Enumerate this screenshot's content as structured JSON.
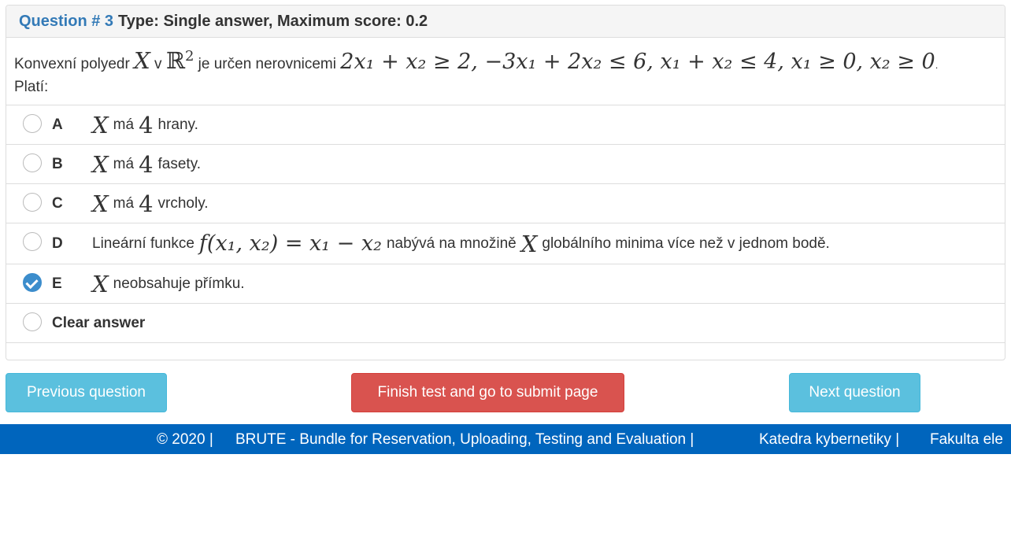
{
  "question": {
    "number_label": "Question # 3",
    "meta": "Type: Single answer, Maximum score: 0.2",
    "stem": {
      "part1": "Konvexní polyedr",
      "var_X": "X",
      "v": "v",
      "R": "ℝ",
      "sup2": "2",
      "part2": "je určen nerovnicemi",
      "formula": "2x₁ + x₂ ≥ 2, −3x₁ + 2x₂ ≤ 6, x₁ + x₂ ≤ 4, x₁ ≥ 0, x₂ ≥ 0",
      "dot": ".",
      "line2": "Platí:"
    }
  },
  "options": [
    {
      "letter": "A",
      "var": "X",
      "text1": "má",
      "num": "4",
      "text2": "hrany.",
      "checked": false
    },
    {
      "letter": "B",
      "var": "X",
      "text1": "má",
      "num": "4",
      "text2": "fasety.",
      "checked": false
    },
    {
      "letter": "C",
      "var": "X",
      "text1": "má",
      "num": "4",
      "text2": "vrcholy.",
      "checked": false
    },
    {
      "letter": "D",
      "text1": "Lineární funkce",
      "formula": "f(x₁, x₂) = x₁ − x₂",
      "text2": "nabývá na množině",
      "var": "X",
      "text3": "globálního minima více než v jednom bodě.",
      "checked": false
    },
    {
      "letter": "E",
      "var": "X",
      "text1": "neobsahuje přímku.",
      "checked": true
    }
  ],
  "clear_answer": "Clear answer",
  "buttons": {
    "previous": "Previous question",
    "finish": "Finish test and go to submit page",
    "next": "Next question"
  },
  "footer": {
    "copyright": "© 2020 |",
    "brute": "BRUTE - Bundle for Reservation, Uploading, Testing and Evaluation |",
    "katedra": "Katedra kybernetiky |",
    "fakulta": "Fakulta ele"
  },
  "colors": {
    "link_blue": "#337ab7",
    "info_button": "#5bc0de",
    "danger_button": "#d9534f",
    "footer_bg": "#0065bd",
    "radio_checked": "#3c8dcc"
  }
}
